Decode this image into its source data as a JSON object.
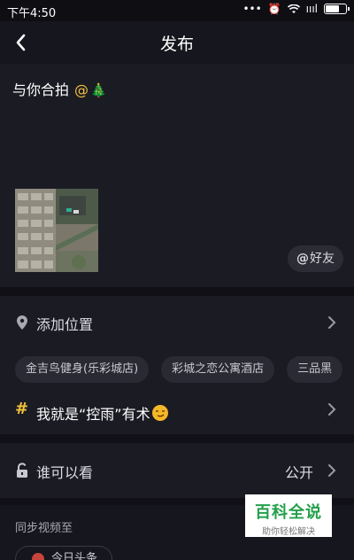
{
  "status": {
    "time": "下午4:50",
    "dots": "•••",
    "alarm": "⏰",
    "signal": "ıııl",
    "battery_level": 0.7
  },
  "nav": {
    "title": "发布"
  },
  "compose": {
    "text": "与你合拍",
    "mention": "@",
    "emoji": "🎄"
  },
  "friend_button": {
    "at": "@",
    "label": "好友"
  },
  "location": {
    "label": "添加位置",
    "chips": [
      "金吉鸟健身(乐彩城店)",
      "彩城之恋公寓酒店",
      "三品黑"
    ]
  },
  "topic": {
    "hash": "#",
    "text": "我就是“控雨”有术"
  },
  "privacy": {
    "label": "谁可以看",
    "value": "公开"
  },
  "sync": {
    "label": "同步视频至",
    "target": "今日头条"
  },
  "watermark": {
    "title": "百科全说",
    "subtitle": "助你轻松解决"
  }
}
